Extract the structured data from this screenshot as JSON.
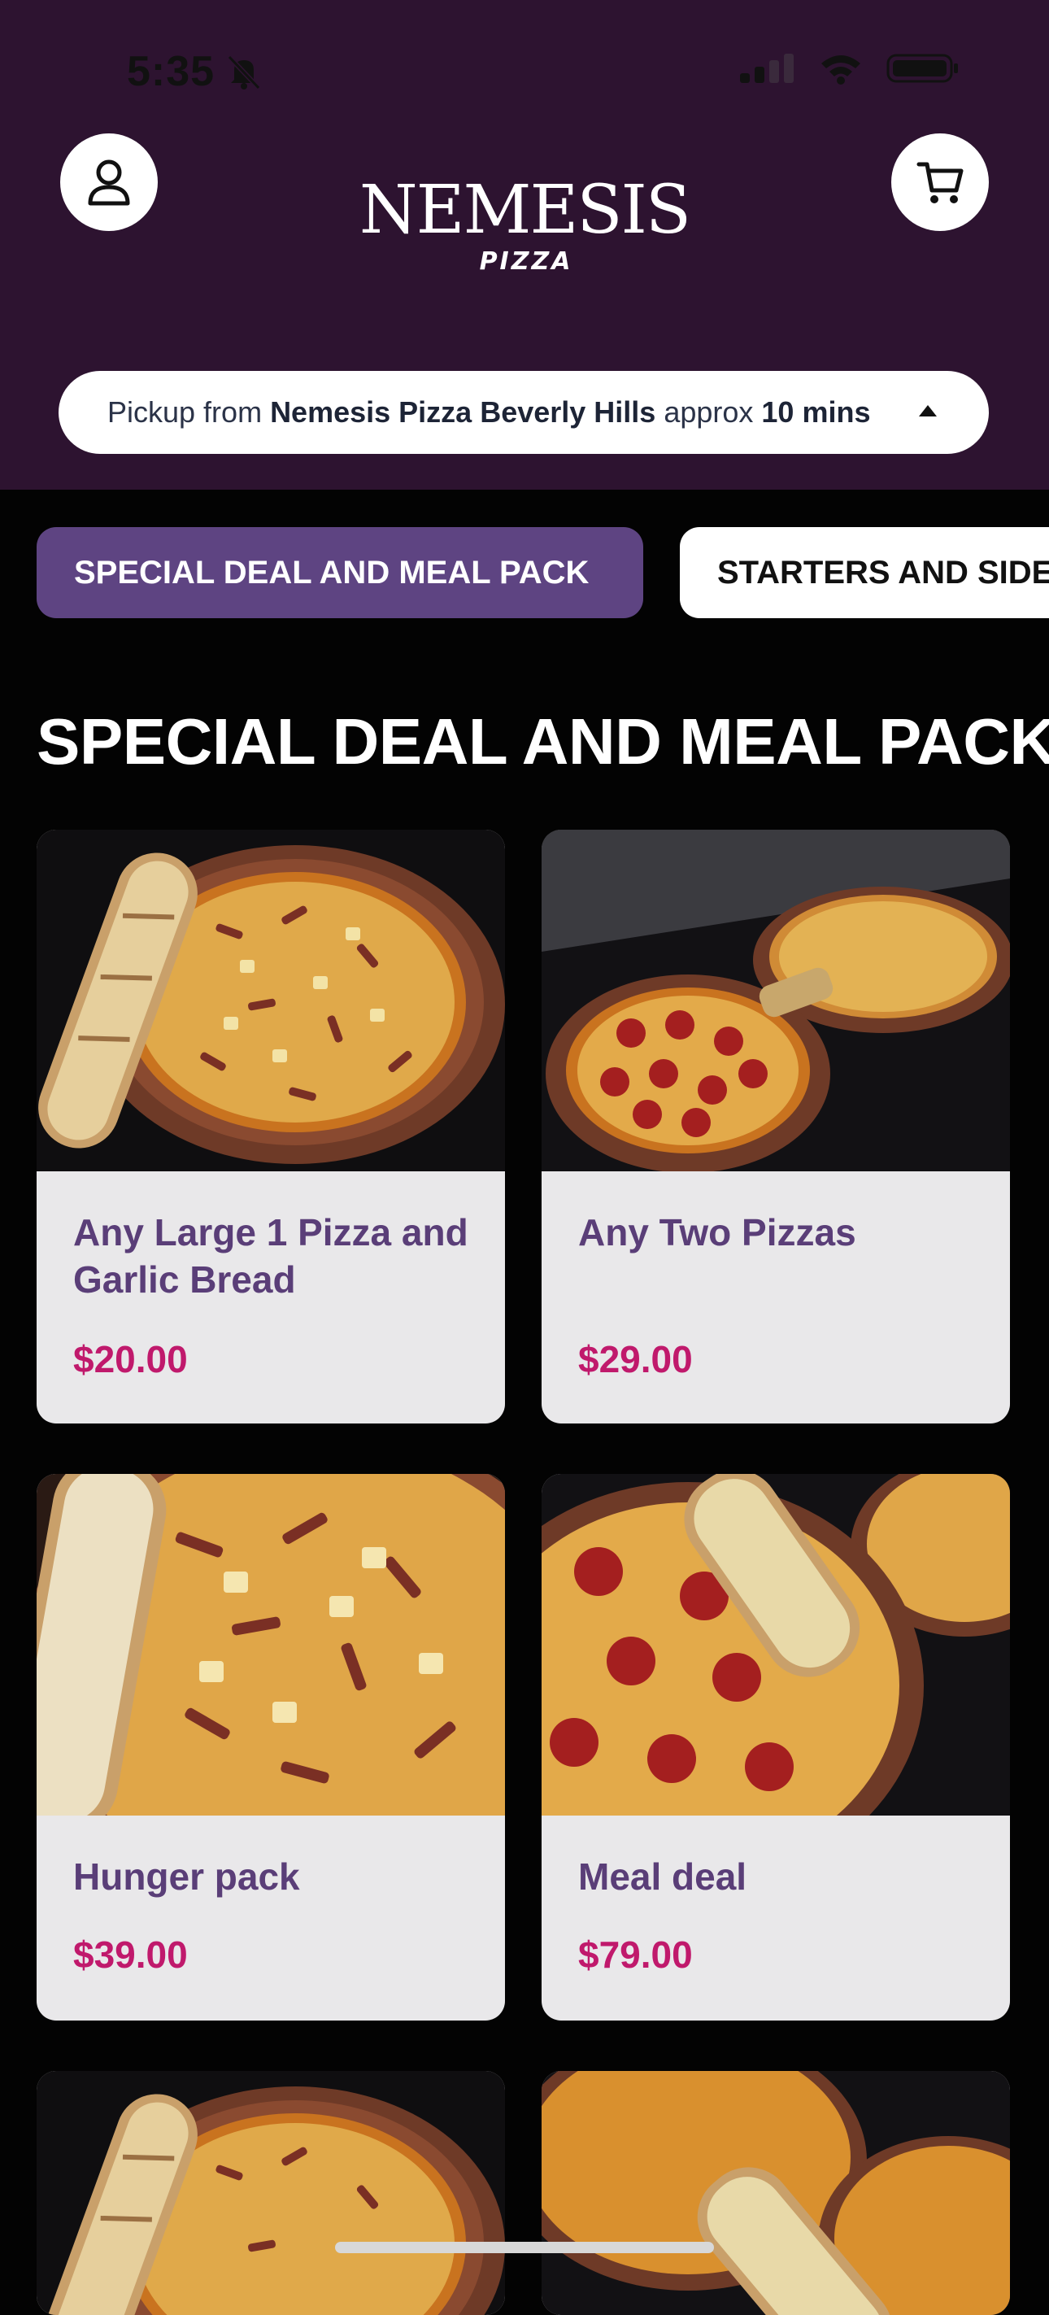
{
  "status_bar": {
    "time": "5:35"
  },
  "header": {
    "logo": {
      "main": "NEMESIS",
      "sub": "PIZZA"
    },
    "icons": {
      "account": "user-icon",
      "cart": "cart-icon"
    }
  },
  "pickup": {
    "prefix": "Pickup from ",
    "store": "Nemesis Pizza Beverly Hills",
    "middle": " approx ",
    "time": "10 mins"
  },
  "tabs": [
    {
      "label": "SPECIAL DEAL AND MEAL PACK",
      "active": true
    },
    {
      "label": "STARTERS AND SIDES",
      "active": false
    }
  ],
  "section": {
    "title": "SPECIAL DEAL AND MEAL PACK"
  },
  "products": [
    {
      "name": "Any Large 1 Pizza and Garlic Bread",
      "price": "$20.00"
    },
    {
      "name": "Any Two Pizzas",
      "price": "$29.00"
    },
    {
      "name": "Hunger pack",
      "price": "$39.00"
    },
    {
      "name": "Meal deal",
      "price": "$79.00"
    }
  ],
  "colors": {
    "header_bg": "#2d1330",
    "page_bg": "#030303",
    "accent": "#5e4482",
    "price": "#c0196c"
  }
}
